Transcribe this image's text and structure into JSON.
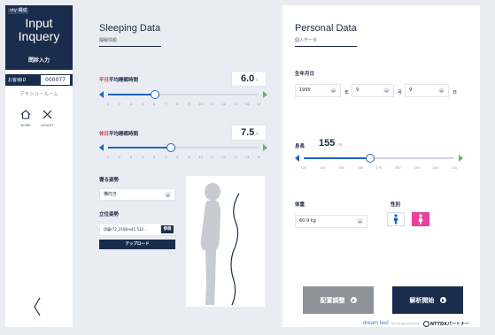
{
  "sidebar": {
    "top_tag": "vty 構成",
    "title": "Input\nInquery",
    "subtitle": "問診入力",
    "customer_label": "お客様ID",
    "customer_id": "000077",
    "room": "デモショールーム",
    "home_label": "HOME",
    "logout_label": "LOGOUT",
    "home_icon": "home-icon",
    "logout_icon": "close-icon",
    "back_icon": "chevron-left-icon"
  },
  "sleeping": {
    "title": "Sleeping Data",
    "subtitle": "睡眠情報",
    "weekday_label_hl": "平日",
    "weekday_label_rest": "平均睡眠時間",
    "weekday_value": "6.0",
    "weekday_unit": "h",
    "holiday_label_hl": "休日",
    "holiday_label_rest": "平均睡眠時間",
    "holiday_value": "7.5",
    "holiday_unit": "h",
    "ticks": [
      "2",
      "3",
      "4",
      "5",
      "6",
      "7",
      "8",
      "9",
      "10",
      "11",
      "12",
      "13",
      "14",
      "15"
    ],
    "posture_label": "寝る姿勢",
    "posture_value": "横向き",
    "standing_label": "立位姿勢",
    "file_value": "伊藤r72_2106re41-532...",
    "browse_label": "参照",
    "upload_label": "アップロード"
  },
  "personal": {
    "title": "Personal Data",
    "subtitle": "個人データ",
    "birth_label": "生年月日",
    "year_value": "1999",
    "year_unit": "年",
    "month_value": "9",
    "month_unit": "月",
    "day_value": "9",
    "day_unit": "日",
    "height_label": "身長",
    "height_value": "155",
    "height_unit": "cm",
    "height_ticks": [
      "120",
      "140",
      "150",
      "160",
      "170",
      "180",
      "190",
      "200",
      "210"
    ],
    "weight_label": "体重",
    "weight_value": "60.9 kg",
    "gender_label": "性別",
    "male_icon": "male-icon",
    "female_icon": "female-icon"
  },
  "actions": {
    "adjust_label": "配置調整",
    "analyze_label": "解析開始"
  },
  "footer": {
    "brand": "dream bed",
    "tech": "Technology provided by",
    "partner": "NTTDXパートナー"
  },
  "colors": {
    "navy": "#1a2c4c",
    "accent_blue": "#1d65c1",
    "arrow_green": "#5db85c",
    "female_pink": "#e8439b",
    "male_blue": "#1d65c1",
    "highlight_red": "#c8344a"
  },
  "slider_values": {
    "weekday_fraction": 0.31,
    "holiday_fraction": 0.42,
    "height_fraction": 0.44
  }
}
